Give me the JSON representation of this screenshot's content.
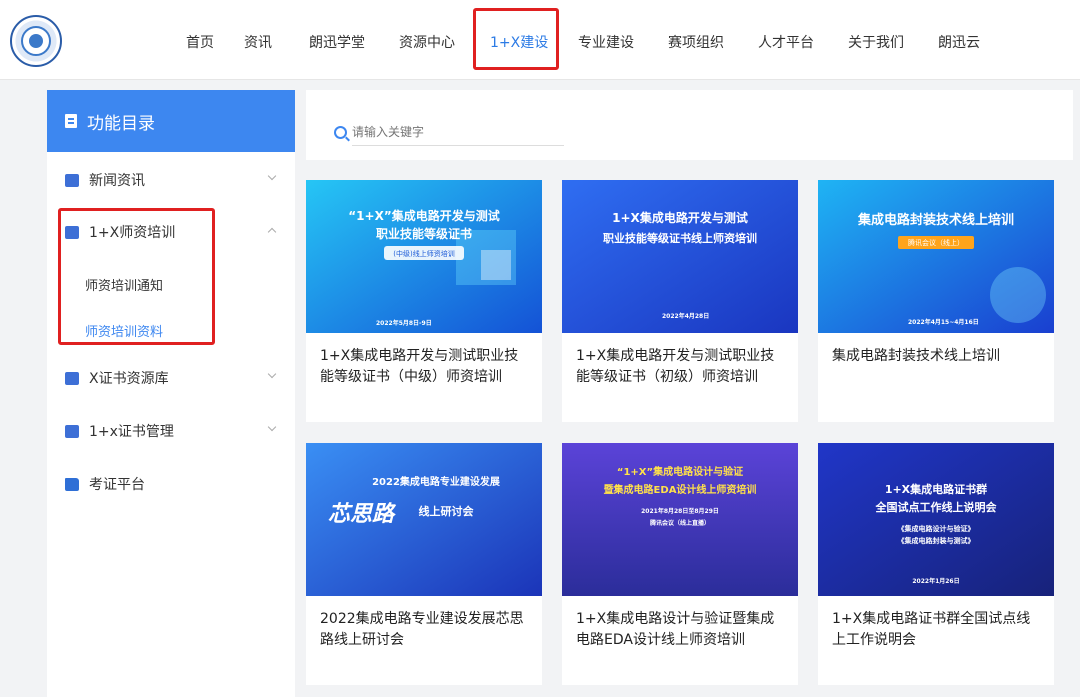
{
  "nav": {
    "items": [
      "首页",
      "资讯",
      "朗迅学堂",
      "资源中心",
      "1+X建设",
      "专业建设",
      "赛项组织",
      "人才平台",
      "关于我们",
      "朗迅云"
    ],
    "active_index": 4
  },
  "sidebar": {
    "title": "功能目录",
    "items": [
      {
        "label": "新闻资讯",
        "icon": "news-icon"
      },
      {
        "label": "1+X师资培训",
        "icon": "calendar-icon"
      },
      {
        "label": "X证书资源库",
        "icon": "book-icon"
      },
      {
        "label": "1+x证书管理",
        "icon": "book-icon"
      },
      {
        "label": "考证平台",
        "icon": "folder-icon"
      }
    ],
    "subitems": [
      "师资培训通知",
      "师资培训资料"
    ],
    "active_sub_index": 1
  },
  "search": {
    "placeholder": "请输入关键字"
  },
  "cards": [
    {
      "title": "1+X集成电路开发与测试职业技能等级证书（中级）师资培训",
      "poster_line1": "“1+X”集成电路开发与测试",
      "poster_line2": "职业技能等级证书",
      "poster_badge": "(中级)线上师资培训",
      "poster_date": "2022年5月8日-9日"
    },
    {
      "title": "1+X集成电路开发与测试职业技能等级证书（初级）师资培训",
      "poster_line1": "1+X集成电路开发与测试",
      "poster_line2": "职业技能等级证书线上师资培训",
      "poster_date": "2022年4月28日"
    },
    {
      "title": "集成电路封装技术线上培训",
      "poster_line1": "集成电路封装技术线上培训",
      "poster_badge": "腾讯会议（线上）",
      "poster_date": "2022年4月15~4月16日"
    },
    {
      "title": "2022集成电路专业建设发展芯思路线上研讨会",
      "poster_line1": "2022集成电路专业建设发展",
      "poster_line2": "芯思路",
      "poster_line3": "线上研讨会"
    },
    {
      "title": "1+X集成电路设计与验证暨集成电路EDA设计线上师资培训",
      "poster_line1": "“1+X”集成电路设计与验证",
      "poster_line2": "暨集成电路EDA设计线上师资培训",
      "poster_date": "2021年8月28日至8月29日",
      "poster_badge": "腾讯会议（线上直播）"
    },
    {
      "title": "1+X集成电路证书群全国试点线上工作说明会",
      "poster_line1": "1+X集成电路证书群",
      "poster_line2": "全国试点工作线上说明会",
      "poster_line3": "《集成电路设计与验证》",
      "poster_line4": "《集成电路封装与测试》",
      "poster_date": "2022年1月26日"
    }
  ],
  "colors": {
    "accent": "#3d87f0",
    "highlight": "#e02020"
  }
}
